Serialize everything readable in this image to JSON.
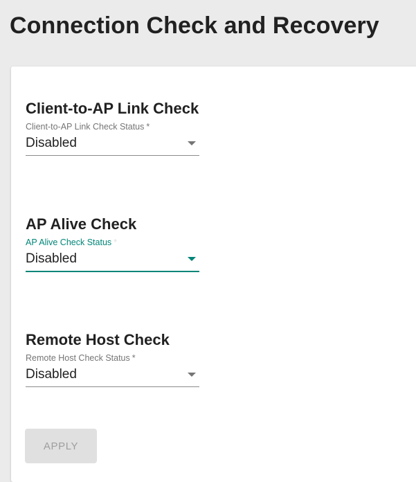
{
  "page": {
    "title": "Connection Check and Recovery"
  },
  "sections": [
    {
      "title": "Client-to-AP Link Check",
      "field_label": "Client-to-AP Link Check Status",
      "required_mark": "*",
      "value": "Disabled",
      "focused": false
    },
    {
      "title": "AP Alive Check",
      "field_label": "AP Alive Check Status",
      "required_mark": "*",
      "value": "Disabled",
      "focused": true
    },
    {
      "title": "Remote Host Check",
      "field_label": "Remote Host Check Status",
      "required_mark": "*",
      "value": "Disabled",
      "focused": false
    }
  ],
  "actions": {
    "apply_label": "APPLY",
    "apply_enabled": false
  },
  "colors": {
    "accent": "#008577",
    "disabled_button_bg": "#e0e0e0",
    "disabled_button_text": "#9e9e9e",
    "page_background": "#ebebeb"
  }
}
